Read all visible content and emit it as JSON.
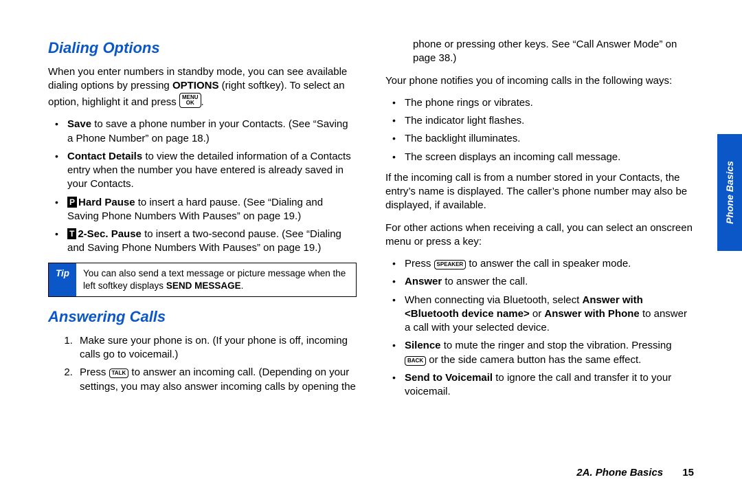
{
  "sideTab": "Phone Basics",
  "footer": {
    "section": "2A. Phone Basics",
    "page": "15"
  },
  "icons": {
    "P": "P",
    "T": "T"
  },
  "keys": {
    "menu_ok": "MENU\nOK",
    "talk": "TALK",
    "speaker": "SPEAKER",
    "back": "BACK"
  },
  "tip": {
    "label": "Tip",
    "text_pre": "You can also send a text message or picture message when the left softkey displays ",
    "text_bold": "SEND MESSAGE",
    "text_post": "."
  },
  "left": {
    "h_dialing": "Dialing Options",
    "p1_pre": "When you enter numbers in standby mode, you can see available dialing options by pressing ",
    "p1_bold": "OPTIONS",
    "p1_mid": " (right softkey). To select an option, highlight it and press ",
    "p1_post": ".",
    "b_save_label": "Save",
    "b_save_text": " to save a phone number in your Contacts. (See “Saving a Phone Number” on page 18.)",
    "b_contact_label": "Contact Details",
    "b_contact_text": " to view the detailed information of a Contacts entry when the number you have entered is already saved in your Contacts.",
    "b_hard_label": "Hard Pause",
    "b_hard_text": " to insert a hard pause. (See “Dialing and Saving Phone Numbers With Pauses” on page 19.)",
    "b_2sec_label": "2-Sec. Pause",
    "b_2sec_text": " to insert a two-second pause. (See “Dialing and Saving Phone Numbers With Pauses” on page 19.)",
    "h_answering": "Answering Calls",
    "ol1": "Make sure your phone is on. (If your phone is off, incoming calls go to voicemail.)",
    "ol2_pre": "Press ",
    "ol2_post": " to answer an incoming call. (Depending on your settings, you may also answer incoming calls by opening the"
  },
  "right": {
    "cont": "phone or pressing other keys. See “Call Answer Mode” on page 38.)",
    "p_notify": "Your phone notifies you of incoming calls in the following ways:",
    "n1": "The phone rings or vibrates.",
    "n2": "The indicator light flashes.",
    "n3": "The backlight illuminates.",
    "n4": "The screen displays an incoming call message.",
    "p_stored": "If the incoming call is from a number stored in your Contacts, the entry’s name is displayed. The caller’s phone number may also be displayed, if available.",
    "p_other": "For other actions when receiving a call, you can select an onscreen menu or press a key:",
    "a1_pre": "Press ",
    "a1_post": " to answer the call in speaker mode.",
    "a2_label": "Answer",
    "a2_text": " to answer the call.",
    "a3_pre": "When connecting via Bluetooth, select ",
    "a3_b1": "Answer with <Bluetooth device name>",
    "a3_mid": " or ",
    "a3_b2": "Answer with Phone",
    "a3_post": " to answer a call with your selected device.",
    "a4_label": "Silence",
    "a4_mid": " to mute the ringer and stop the vibration. Pressing ",
    "a4_post": " or the side camera button has the same effect.",
    "a5_label": "Send to Voicemail",
    "a5_text": " to ignore the call and transfer it to your voicemail."
  }
}
